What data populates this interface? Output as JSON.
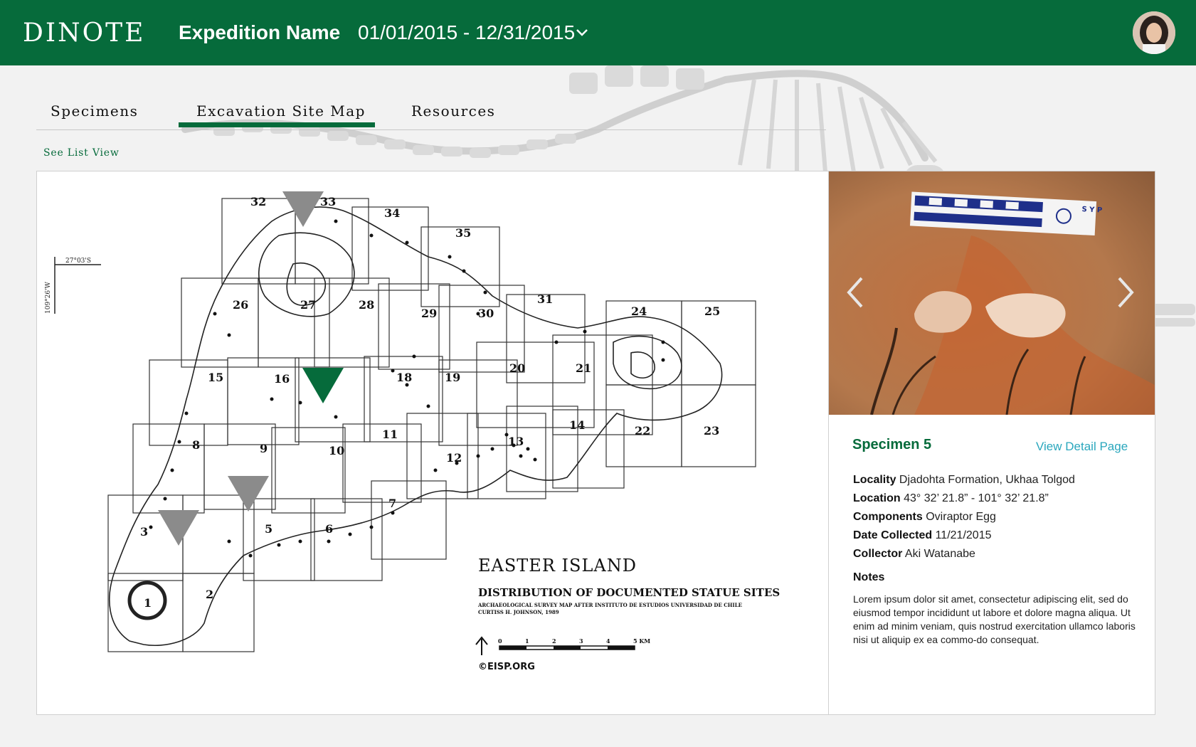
{
  "header": {
    "logo": "DINOTE",
    "expedition_name": "Expedition Name",
    "date_range": "01/01/2015 - 12/31/2015"
  },
  "tabs": [
    {
      "label": "Specimens"
    },
    {
      "label": "Excavation Site Map",
      "active": true
    },
    {
      "label": "Resources"
    }
  ],
  "list_view_link": "See List View",
  "map": {
    "title": "EASTER ISLAND",
    "subtitle": "DISTRIBUTION OF DOCUMENTED STATUE SITES",
    "credit_line1": "ARCHAEOLOGICAL SURVEY MAP AFTER INSTITUTO DE ESTUDIOS UNIVERSIDAD DE CHILE",
    "credit_line2": "CURTISS H. JOHNSON, 1989",
    "scale_labels": [
      "0",
      "1",
      "2",
      "3",
      "4",
      "5 KM"
    ],
    "copyright": "©EISP.ORG",
    "lat_label": "27°03'S",
    "lon_label": "109°26'W",
    "grid_numbers": [
      "1",
      "2",
      "3",
      "5",
      "6",
      "7",
      "8",
      "9",
      "10",
      "11",
      "12",
      "13",
      "14",
      "15",
      "16",
      "18",
      "19",
      "20",
      "21",
      "22",
      "23",
      "24",
      "25",
      "26",
      "27",
      "28",
      "29",
      "30",
      "31",
      "32",
      "33",
      "34",
      "35"
    ],
    "markers": [
      {
        "type": "specimen",
        "color": "#8b8b8b"
      },
      {
        "type": "specimen-selected",
        "color": "#066b3b"
      },
      {
        "type": "specimen",
        "color": "#8b8b8b"
      },
      {
        "type": "specimen",
        "color": "#8b8b8b"
      }
    ]
  },
  "specimen": {
    "title": "Specimen 5",
    "detail_link": "View Detail Page",
    "locality_label": "Locality",
    "locality": "Djadohta Formation, Ukhaa Tolgod",
    "location_label": "Location",
    "location": "43° 32’ 21.8” -  101° 32’ 21.8”",
    "components_label": "Components",
    "components": "Oviraptor Egg",
    "date_label": "Date Collected",
    "date": "11/21/2015",
    "collector_label": "Collector",
    "collector": "Aki Watanabe",
    "notes_label": "Notes",
    "notes": "Lorem ipsum dolor sit amet, consectetur adipiscing elit, sed do eiusmod tempor incididunt ut labore et dolore magna aliqua. Ut enim ad minim veniam, quis nostrud exercitation ullamco laboris nisi ut aliquip ex ea commo-do consequat.",
    "scale_card_text": "S Y P"
  },
  "colors": {
    "brand_green": "#066b3b",
    "link_teal": "#2aa7bd",
    "marker_gray": "#8b8b8b"
  },
  "icons": [
    "chevron-down-icon",
    "chevron-left-icon",
    "chevron-right-icon",
    "north-arrow-icon"
  ]
}
